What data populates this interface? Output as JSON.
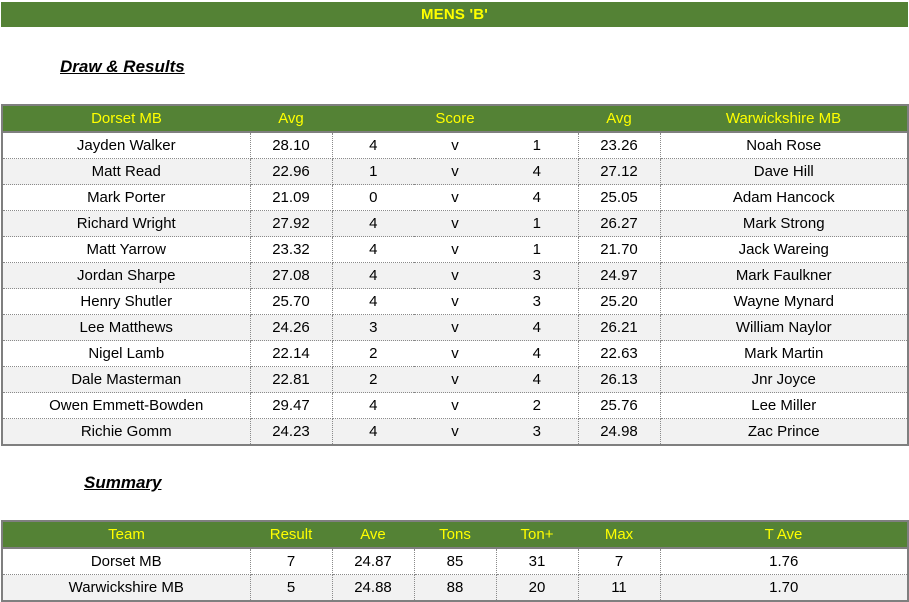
{
  "banner": {
    "title": "MENS 'B'"
  },
  "draw": {
    "section_title": "Draw & Results",
    "headers": {
      "home_team": "Dorset MB",
      "home_avg": "Avg",
      "score": "Score",
      "away_avg": "Avg",
      "away_team": "Warwickshire MB"
    },
    "rows": [
      {
        "home_player": "Jayden Walker",
        "home_avg": "28.10",
        "home_score": "4",
        "vs": "v",
        "away_score": "1",
        "away_avg": "23.26",
        "away_player": "Noah Rose"
      },
      {
        "home_player": "Matt Read",
        "home_avg": "22.96",
        "home_score": "1",
        "vs": "v",
        "away_score": "4",
        "away_avg": "27.12",
        "away_player": "Dave Hill"
      },
      {
        "home_player": "Mark Porter",
        "home_avg": "21.09",
        "home_score": "0",
        "vs": "v",
        "away_score": "4",
        "away_avg": "25.05",
        "away_player": "Adam Hancock"
      },
      {
        "home_player": "Richard Wright",
        "home_avg": "27.92",
        "home_score": "4",
        "vs": "v",
        "away_score": "1",
        "away_avg": "26.27",
        "away_player": "Mark Strong"
      },
      {
        "home_player": "Matt Yarrow",
        "home_avg": "23.32",
        "home_score": "4",
        "vs": "v",
        "away_score": "1",
        "away_avg": "21.70",
        "away_player": "Jack Wareing"
      },
      {
        "home_player": "Jordan Sharpe",
        "home_avg": "27.08",
        "home_score": "4",
        "vs": "v",
        "away_score": "3",
        "away_avg": "24.97",
        "away_player": "Mark Faulkner"
      },
      {
        "home_player": "Henry Shutler",
        "home_avg": "25.70",
        "home_score": "4",
        "vs": "v",
        "away_score": "3",
        "away_avg": "25.20",
        "away_player": "Wayne Mynard"
      },
      {
        "home_player": "Lee Matthews",
        "home_avg": "24.26",
        "home_score": "3",
        "vs": "v",
        "away_score": "4",
        "away_avg": "26.21",
        "away_player": "William Naylor"
      },
      {
        "home_player": "Nigel Lamb",
        "home_avg": "22.14",
        "home_score": "2",
        "vs": "v",
        "away_score": "4",
        "away_avg": "22.63",
        "away_player": "Mark Martin"
      },
      {
        "home_player": "Dale Masterman",
        "home_avg": "22.81",
        "home_score": "2",
        "vs": "v",
        "away_score": "4",
        "away_avg": "26.13",
        "away_player": "Jnr Joyce"
      },
      {
        "home_player": "Owen Emmett-Bowden",
        "home_avg": "29.47",
        "home_score": "4",
        "vs": "v",
        "away_score": "2",
        "away_avg": "25.76",
        "away_player": "Lee Miller"
      },
      {
        "home_player": "Richie Gomm",
        "home_avg": "24.23",
        "home_score": "4",
        "vs": "v",
        "away_score": "3",
        "away_avg": "24.98",
        "away_player": "Zac Prince"
      }
    ]
  },
  "summary": {
    "section_title": "Summary",
    "headers": {
      "team": "Team",
      "result": "Result",
      "ave": "Ave",
      "tons": "Tons",
      "ton_plus": "Ton+",
      "max": "Max",
      "t_ave": "T Ave"
    },
    "rows": [
      {
        "team": "Dorset MB",
        "result": "7",
        "ave": "24.87",
        "tons": "85",
        "ton_plus": "31",
        "max": "7",
        "t_ave": "1.76"
      },
      {
        "team": "Warwickshire MB",
        "result": "5",
        "ave": "24.88",
        "tons": "88",
        "ton_plus": "20",
        "max": "11",
        "t_ave": "1.70"
      }
    ]
  },
  "colors": {
    "header_green": "#548235",
    "header_text_yellow": "#ffff00",
    "alt_row": "#f2f2f2"
  }
}
